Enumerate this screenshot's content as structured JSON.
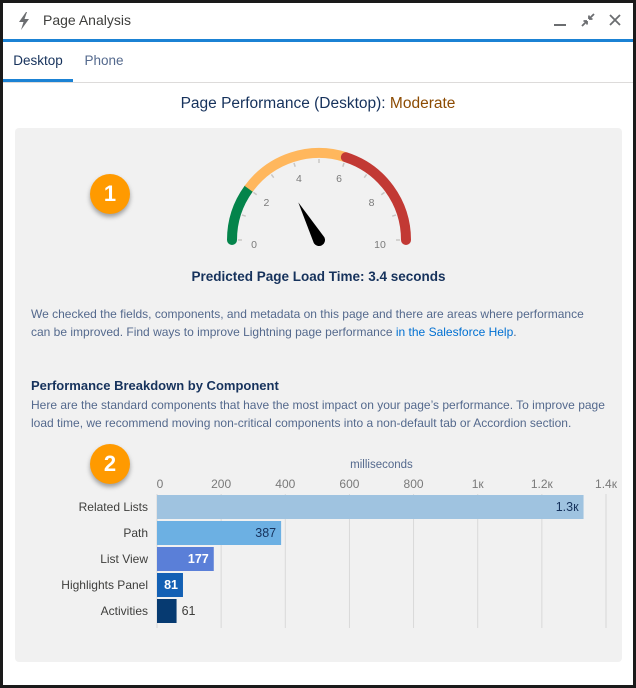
{
  "window": {
    "title": "Page Analysis",
    "icon": "lightning-bolt-icon",
    "controls": [
      "minimize-icon",
      "restore-icon",
      "close-icon"
    ]
  },
  "tabs": [
    {
      "label": "Desktop",
      "active": true
    },
    {
      "label": "Phone",
      "active": false
    }
  ],
  "header": {
    "prefix": "Page Performance (Desktop): ",
    "rating": "Moderate",
    "rating_color": "#8c4b02"
  },
  "badges": [
    "1",
    "2"
  ],
  "gauge": {
    "min": 0,
    "max": 10,
    "value": 3.4,
    "tick_labels": [
      "0",
      "2",
      "4",
      "6",
      "8",
      "10"
    ],
    "bands": [
      {
        "from": 0,
        "to": 2,
        "color": "#04844b"
      },
      {
        "from": 2,
        "to": 6,
        "color": "#ffb75d"
      },
      {
        "from": 6,
        "to": 10,
        "color": "#c23934"
      }
    ]
  },
  "load_time": "Predicted Page Load Time: 3.4 seconds",
  "description": {
    "text": "We checked the fields, components, and metadata on this page and there are areas where performance can be improved. Find ways to improve Lightning page performance ",
    "link": "in the Salesforce Help",
    "suffix": "."
  },
  "breakdown": {
    "title": "Performance Breakdown by Component",
    "text": "Here are the standard components that have the most impact on your page’s performance. To improve page load time, we recommend moving non-critical components into a non-default tab or Accordion section."
  },
  "chart_data": {
    "type": "bar",
    "orientation": "horizontal",
    "title": "",
    "xlabel": "milliseconds",
    "ylabel": "",
    "xlim": [
      0,
      1400
    ],
    "x_ticks": [
      0,
      200,
      400,
      600,
      800,
      1000,
      1200,
      1400
    ],
    "x_tick_labels": [
      "0",
      "200",
      "400",
      "600",
      "800",
      "1к",
      "1.2к",
      "1.4к"
    ],
    "grid": true,
    "categories": [
      "Related Lists",
      "Path",
      "List View",
      "Highlights Panel",
      "Activities"
    ],
    "values": [
      1330,
      387,
      177,
      81,
      61
    ],
    "value_labels": [
      "1.3к",
      "387",
      "177",
      "81",
      "61"
    ],
    "colors": [
      "#9fc3e0",
      "#6cb0e3",
      "#5a7fd8",
      "#1360b4",
      "#063a71"
    ],
    "label_colors": [
      "#16325c",
      "#16325c",
      "#ffffff",
      "#ffffff",
      "#3e3e3c"
    ]
  }
}
